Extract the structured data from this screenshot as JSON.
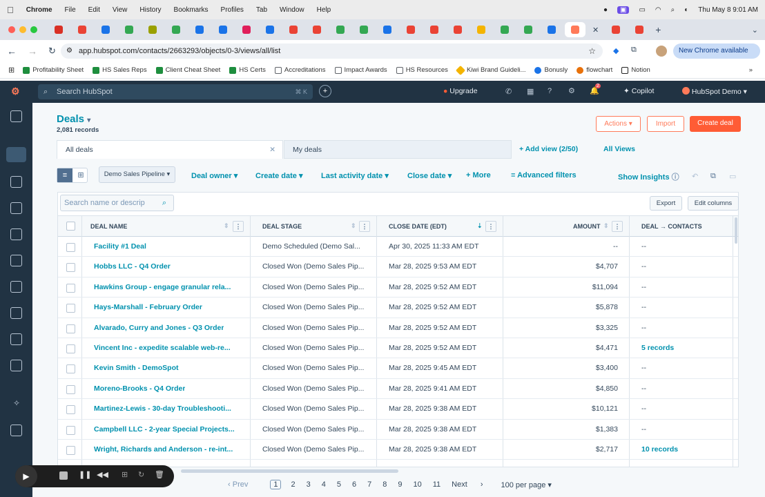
{
  "mac_menu": {
    "apple": "",
    "app": "Chrome",
    "items": [
      "File",
      "Edit",
      "View",
      "History",
      "Bookmarks",
      "Profiles",
      "Tab",
      "Window",
      "Help"
    ],
    "clock": "Thu May 8  9:01 AM"
  },
  "browser": {
    "url": "app.hubspot.com/contacts/2663293/objects/0-3/views/all/list",
    "new_chrome": "New Chrome available"
  },
  "bookmarks": [
    {
      "label": "Profitability Sheet",
      "color": "#1e8e3e"
    },
    {
      "label": "HS Sales Reps",
      "color": "#1e8e3e"
    },
    {
      "label": "Client Cheat Sheet",
      "color": "#1e8e3e"
    },
    {
      "label": "HS Certs",
      "color": "#1e8e3e"
    },
    {
      "label": "Accreditations",
      "color": "#5f6368"
    },
    {
      "label": "Impact Awards",
      "color": "#5f6368"
    },
    {
      "label": "HS Resources",
      "color": "#5f6368"
    },
    {
      "label": "Kiwi Brand Guideli...",
      "color": "#f4b400"
    },
    {
      "label": "Bonusly",
      "color": "#1a73e8"
    },
    {
      "label": "flowchart",
      "color": "#e8710a"
    },
    {
      "label": "Notion",
      "color": "#222"
    }
  ],
  "hubspot_nav": {
    "search": "Search HubSpot",
    "kbd": "⌘ K",
    "upgrade": "Upgrade",
    "copilot": "Copilot",
    "account": "HubSpot Demo",
    "badge": "2"
  },
  "page": {
    "title": "Deals",
    "records": "2,081 records",
    "actions": "Actions",
    "import": "Import",
    "create": "Create deal"
  },
  "views": {
    "all": "All deals",
    "my": "My deals",
    "add": "+ Add view (2/50)",
    "all_views": "All Views"
  },
  "filters": {
    "pipeline": "Demo Sales Pipeline",
    "owner": "Deal owner",
    "create": "Create date",
    "activity": "Last activity date",
    "close": "Close date",
    "more": "+ More",
    "advanced": "Advanced filters",
    "insights": "Show Insights"
  },
  "table_tools": {
    "search_placeholder": "Search name or descrip",
    "export": "Export",
    "edit_columns": "Edit columns"
  },
  "columns": [
    "DEAL NAME",
    "DEAL STAGE",
    "CLOSE DATE (EDT)",
    "AMOUNT",
    "DEAL → CONTACTS"
  ],
  "rows": [
    {
      "name": "Facility #1 Deal",
      "stage": "Demo Scheduled (Demo Sal...",
      "close": "Apr 30, 2025 11:33 AM EDT",
      "amount": "--",
      "contacts": "--"
    },
    {
      "name": "Hobbs LLC - Q4 Order",
      "stage": "Closed Won (Demo Sales Pip...",
      "close": "Mar 28, 2025 9:53 AM EDT",
      "amount": "$4,707",
      "contacts": "--"
    },
    {
      "name": "Hawkins Group - engage granular rela...",
      "stage": "Closed Won (Demo Sales Pip...",
      "close": "Mar 28, 2025 9:52 AM EDT",
      "amount": "$11,094",
      "contacts": "--"
    },
    {
      "name": "Hays-Marshall - February Order",
      "stage": "Closed Won (Demo Sales Pip...",
      "close": "Mar 28, 2025 9:52 AM EDT",
      "amount": "$5,878",
      "contacts": "--"
    },
    {
      "name": "Alvarado, Curry and Jones - Q3 Order",
      "stage": "Closed Won (Demo Sales Pip...",
      "close": "Mar 28, 2025 9:52 AM EDT",
      "amount": "$3,325",
      "contacts": "--"
    },
    {
      "name": "Vincent Inc - expedite scalable web-re...",
      "stage": "Closed Won (Demo Sales Pip...",
      "close": "Mar 28, 2025 9:52 AM EDT",
      "amount": "$4,471",
      "contacts": "5 records"
    },
    {
      "name": "Kevin Smith - DemoSpot",
      "stage": "Closed Won (Demo Sales Pip...",
      "close": "Mar 28, 2025 9:45 AM EDT",
      "amount": "$3,400",
      "contacts": "--"
    },
    {
      "name": "Moreno-Brooks - Q4 Order",
      "stage": "Closed Won (Demo Sales Pip...",
      "close": "Mar 28, 2025 9:41 AM EDT",
      "amount": "$4,850",
      "contacts": "--"
    },
    {
      "name": "Martinez-Lewis - 30-day Troubleshooti...",
      "stage": "Closed Won (Demo Sales Pip...",
      "close": "Mar 28, 2025 9:38 AM EDT",
      "amount": "$10,121",
      "contacts": "--"
    },
    {
      "name": "Campbell LLC - 2-year Special Projects...",
      "stage": "Closed Won (Demo Sales Pip...",
      "close": "Mar 28, 2025 9:38 AM EDT",
      "amount": "$1,383",
      "contacts": "--"
    },
    {
      "name": "Wright, Richards and Anderson - re-int...",
      "stage": "Closed Won (Demo Sales Pip...",
      "close": "Mar 28, 2025 9:38 AM EDT",
      "amount": "$2,717",
      "contacts": "10 records"
    }
  ],
  "pagination": {
    "prev": "Prev",
    "pages": [
      "1",
      "2",
      "3",
      "4",
      "5",
      "6",
      "7",
      "8",
      "9",
      "10",
      "11"
    ],
    "current": "1",
    "next": "Next",
    "per_page": "100 per page"
  }
}
